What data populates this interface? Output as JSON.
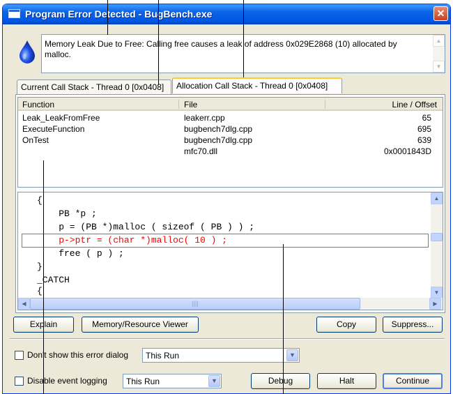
{
  "window": {
    "title": "Program Error Detected - BugBench.exe",
    "close_glyph": "✕"
  },
  "icons": {
    "title": "app-window-icon",
    "error": "water-drop-icon",
    "close": "close-icon"
  },
  "message": "Memory Leak Due to Free: Calling free causes a leak of address 0x029E2868 (10) allocated by malloc.",
  "tabs": [
    {
      "label": "Current Call Stack - Thread 0 [0x0408]",
      "active": false
    },
    {
      "label": "Allocation Call Stack - Thread 0 [0x0408]",
      "active": true
    }
  ],
  "stack_table": {
    "columns": [
      "Function",
      "File",
      "Line / Offset"
    ],
    "rows": [
      {
        "function": "Leak_LeakFromFree",
        "file": "leakerr.cpp",
        "line": "65"
      },
      {
        "function": "ExecuteFunction",
        "file": "bugbench7dlg.cpp",
        "line": "695"
      },
      {
        "function": "OnTest",
        "file": "bugbench7dlg.cpp",
        "line": "639"
      },
      {
        "function": "",
        "file": "mfc70.dll",
        "line": "0x0001843D"
      }
    ]
  },
  "code": {
    "lines": [
      {
        "text": "{",
        "highlight": false
      },
      {
        "text": "    PB *p ;",
        "highlight": false
      },
      {
        "text": "    p = (PB *)malloc ( sizeof ( PB ) ) ;",
        "highlight": false
      },
      {
        "text": "    p->ptr = (char *)malloc( 10 ) ;",
        "highlight": true
      },
      {
        "text": "    free ( p ) ;",
        "highlight": false
      },
      {
        "text": "}",
        "highlight": false
      },
      {
        "text": "_CATCH",
        "highlight": false
      },
      {
        "text": "{",
        "highlight": false
      }
    ],
    "highlight_color": "#ff0000"
  },
  "buttons": {
    "explain": "Explain",
    "memory_viewer": "Memory/Resource Viewer",
    "copy": "Copy",
    "suppress": "Suppress...",
    "debug": "Debug",
    "halt": "Halt",
    "continue": "Continue"
  },
  "options": {
    "dont_show": {
      "label": "Don't show this error dialog",
      "checked": false,
      "select_value": "This Run"
    },
    "disable_logging": {
      "label": "Disable event logging",
      "checked": false,
      "select_value": "This Run"
    }
  },
  "scroll_glyphs": {
    "up": "▲",
    "down": "▼",
    "left": "◀",
    "right": "▶",
    "grip": "||||"
  },
  "colors": {
    "title_bar": "#0054e3",
    "active_tab_accent": "#ffc83c",
    "dialog_bg": "#ece9d8"
  }
}
